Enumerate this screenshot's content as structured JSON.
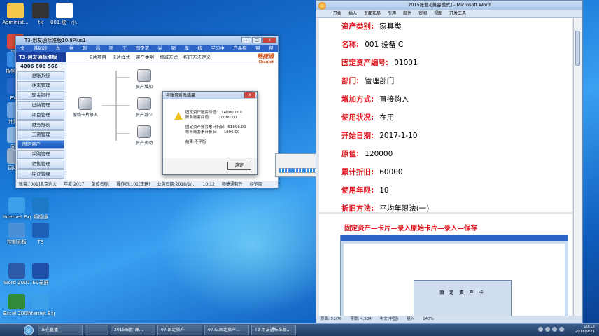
{
  "desktop": {
    "icons": [
      {
        "label": "Administ...",
        "color": "#f2c94c"
      },
      {
        "label": "tk",
        "color": "#333333"
      },
      {
        "label": "001.统一小..规模纳税人...",
        "color": "#ffffff"
      },
      {
        "label": "现代",
        "color": "#d94a3a"
      },
      {
        "label": "搜狗浏...",
        "color": "#3a8ee6"
      },
      {
        "label": "EV...",
        "color": "#2a6acb"
      },
      {
        "label": "计算...",
        "color": "#6fa5e0"
      },
      {
        "label": "网...",
        "color": "#8cb8e6"
      },
      {
        "label": "回收...",
        "color": "#9ab0c8"
      },
      {
        "label": "Internet Explorer",
        "color": "#3aa0e8"
      },
      {
        "label": "畅捷通",
        "color": "#1e78c8"
      },
      {
        "label": "控制面板",
        "color": "#4a90d9"
      },
      {
        "label": "T3",
        "color": "#1e5fb8"
      },
      {
        "label": "Word 2007",
        "color": "#2a5aa8"
      },
      {
        "label": "EV录屏",
        "color": "#1d4fa8"
      },
      {
        "label": "Excel 2007",
        "color": "#2f8a3a"
      },
      {
        "label": "Internet Explorer",
        "color": "#3aa0e8"
      }
    ]
  },
  "t3": {
    "title": "T3-用友通标准版10.8Plus1",
    "menu": [
      "文件",
      "基础设置",
      "总账",
      "往来",
      "现金",
      "出纳",
      "项目",
      "工资",
      "固定资产",
      "采购",
      "销售",
      "库存",
      "核算",
      "学习中心",
      "产品服务",
      "窗口",
      "帮助"
    ],
    "brand": "T3-用友通标准版",
    "phone": "4006 600 566",
    "nav": [
      "总账系统",
      "往来管理",
      "现金银行",
      "出纳管理",
      "项目管理",
      "财务报表",
      "工资管理",
      "固定资产",
      "采购管理",
      "销售管理",
      "库存管理"
    ],
    "active_nav": "固定资产",
    "toolbar": [
      "卡片项目",
      "卡片样式",
      "资产类别",
      "增减方式",
      "折旧方法定义"
    ],
    "logo": "畅捷通",
    "logo_sub": "Chanjet",
    "flow": [
      "原始卡片录入",
      "资产增加",
      "资产减少",
      "资产变动"
    ],
    "status": [
      "账套:[001]北京达大",
      "年度:2017",
      "单位名称:",
      "操作员:101(王建)",
      "业务日期:2018/1/...",
      "10:12",
      "畅捷通软件",
      "经销商"
    ],
    "win": {
      "min": "-",
      "max": "□",
      "close": "x"
    }
  },
  "dialog": {
    "title": "与账务对账结果",
    "close": "x",
    "lines": [
      "固定资产账套原值:   140000.00",
      "账务账套原值:       70000.00",
      "",
      "固定资产账套累计折旧:  61896.00",
      "账务账套累计折旧:     1896.00",
      "",
      "结果:不平衡"
    ],
    "ok": "确定"
  },
  "progress": {
    "cancel": "取消",
    "fraction": 0.95
  },
  "word": {
    "title": "2015账套-[兼容模式] - Microsoft Word",
    "ribbon": [
      "开始",
      "插入",
      "页面布局",
      "引用",
      "邮件",
      "审阅",
      "视图",
      "开发工具"
    ],
    "lines": [
      {
        "label": "资产类别:",
        "value": "家具类"
      },
      {
        "label": "名称:",
        "value": "001 设备 C"
      },
      {
        "label": "固定资产编号:",
        "value": "01001"
      },
      {
        "label": "部门:",
        "value": "管理部门"
      },
      {
        "label": "增加方式:",
        "value": "直接购入"
      },
      {
        "label": "使用状况:",
        "value": "在用"
      },
      {
        "label": "开始日期:",
        "value": "2017-1-10"
      },
      {
        "label": "原值:",
        "value": "120000"
      },
      {
        "label": "累计折旧:",
        "value": "60000"
      },
      {
        "label": "使用年限:",
        "value": "10"
      },
      {
        "label": "折旧方法:",
        "value": "平均年限法(一)"
      }
    ],
    "heading": "固定资产—卡片—录入原始卡片—录入—保存",
    "embed_card": "固 定 资 产 卡",
    "status": [
      "页面: 51/76",
      "字数: 4,584",
      "中文(中国)",
      "插入",
      "140%"
    ]
  },
  "taskbar": {
    "items": [
      "正在直播",
      "",
      "2015账套(兼...",
      "07.固定资产",
      "07.&.固定资产...",
      "T3-用友通标准版..."
    ],
    "time": "10:12",
    "date": "2018/9/21"
  }
}
